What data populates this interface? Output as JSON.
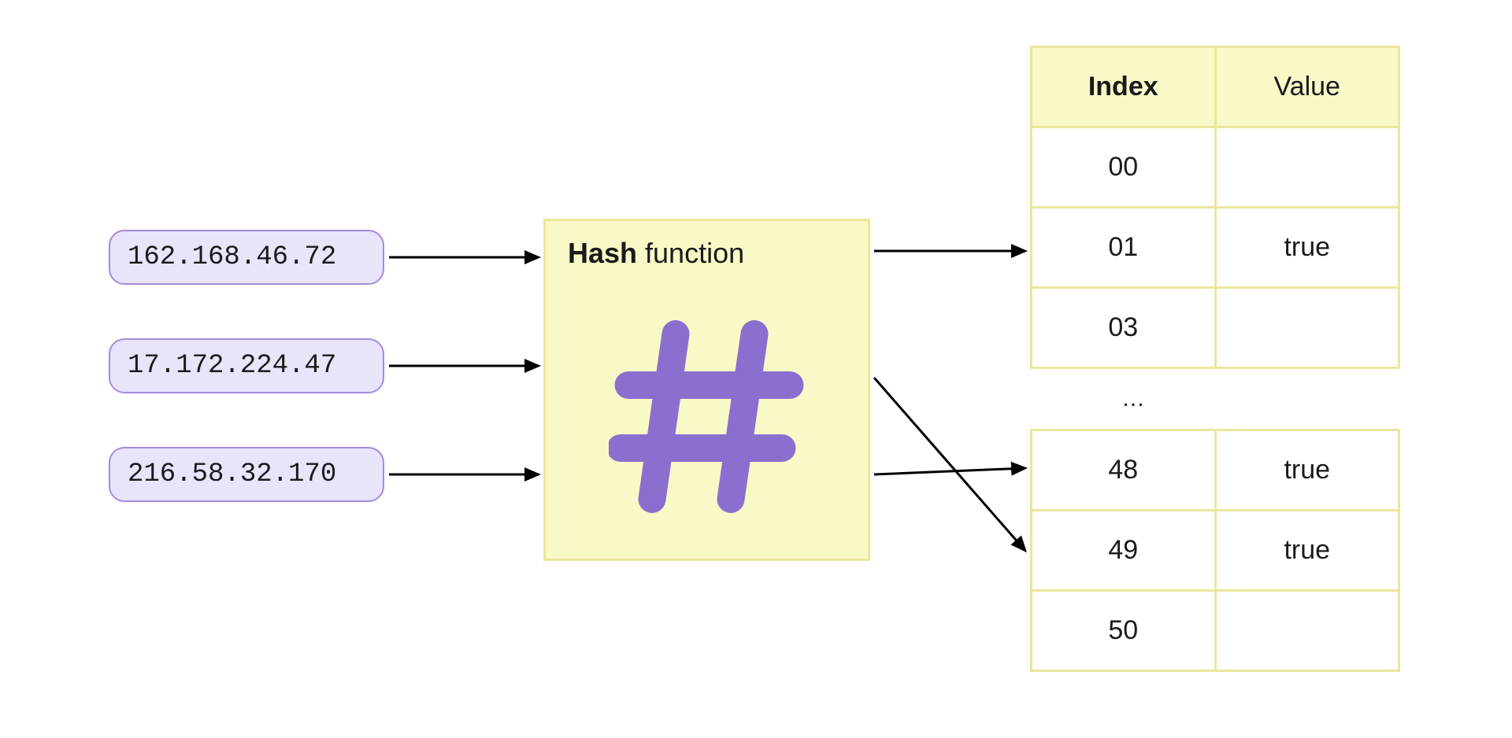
{
  "inputs": [
    "162.168.46.72",
    "17.172.224.47",
    "216.58.32.170"
  ],
  "hash_box": {
    "title_bold": "Hash",
    "title_rest": " function"
  },
  "table_headers": {
    "index": "Index",
    "value": "Value"
  },
  "table_top": [
    {
      "index": "00",
      "value": ""
    },
    {
      "index": "01",
      "value": "true"
    },
    {
      "index": "03",
      "value": ""
    }
  ],
  "ellipsis": "…",
  "table_bottom": [
    {
      "index": "48",
      "value": "true"
    },
    {
      "index": "49",
      "value": "true"
    },
    {
      "index": "50",
      "value": ""
    }
  ],
  "colors": {
    "pill_bg": "#e8e4fa",
    "pill_border": "#a78bdb",
    "box_bg": "#f9f8c7",
    "box_border": "#ebe79b",
    "hash_glyph": "#8b6fcf",
    "arrow": "#000000"
  }
}
